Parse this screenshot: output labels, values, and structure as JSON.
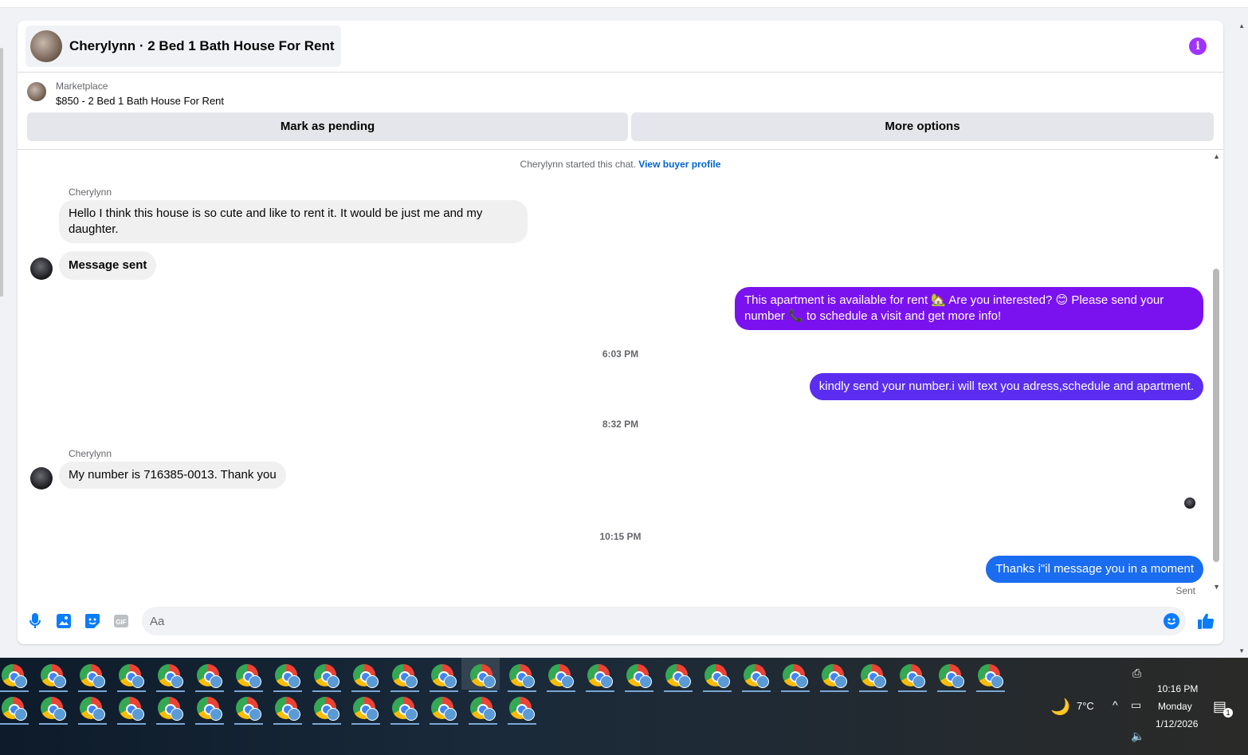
{
  "header": {
    "title": "Cherylynn · 2 Bed 1 Bath House For Rent",
    "info_icon": "i"
  },
  "marketplace": {
    "label": "Marketplace",
    "listing": "$850 - 2 Bed 1 Bath House For Rent",
    "pending_button": "Mark as pending",
    "more_button": "More options"
  },
  "chat": {
    "started_text": "Cherylynn started this chat.",
    "started_link": "View buyer profile",
    "sender_1": "Cherylynn",
    "msg_1": "Hello I think this house is so cute and like to rent it. It would be just me and my daughter.",
    "msg_2": "Message sent",
    "msg_3": "This apartment is available for rent 🏡 Are you interested? 😊 Please send your number 📞 to schedule a visit and get more info!",
    "time_1": "6:03 PM",
    "msg_4": "kindly send your number.i will text you adress,schedule and apartment.",
    "time_2": "8:32 PM",
    "sender_2": "Cherylynn",
    "msg_5": "My number is 716385-0013. Thank you",
    "time_3": "10:15 PM",
    "msg_6": "Thanks i\"il message you in a moment",
    "sent_label": "Sent"
  },
  "composer": {
    "placeholder": "Aa",
    "icons": [
      "microphone-icon",
      "photo-icon",
      "sticker-icon",
      "gif-icon",
      "emoji-icon",
      "thumbs-up-icon"
    ],
    "gif_label": "GIF"
  },
  "colors": {
    "accent": "#0a7cff",
    "outgoing_1": "#7a12f0",
    "outgoing_2": "#5b2df0",
    "outgoing_3": "#1a6cf0",
    "info": "#a033ff"
  },
  "taskbar": {
    "weather_temp": "7°C",
    "time": "10:16 PM",
    "day": "Monday",
    "date": "1/12/2026",
    "notifications": "1"
  }
}
